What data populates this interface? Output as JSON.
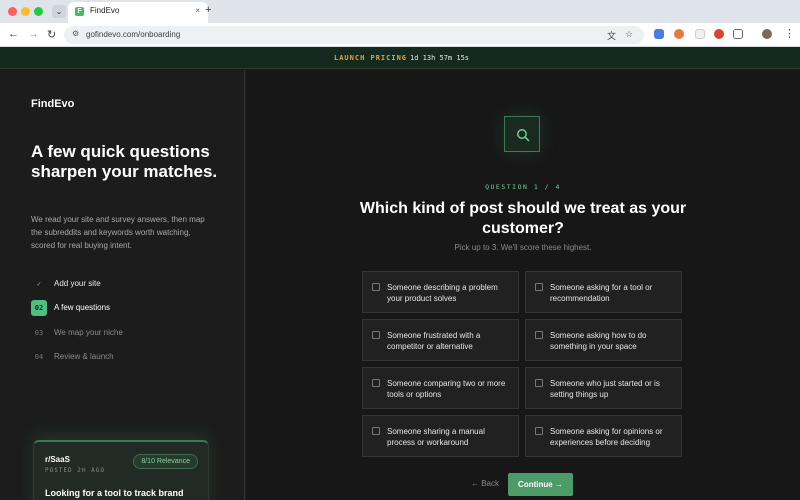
{
  "browser": {
    "tab_title": "FindEvo",
    "favicon_letter": "F",
    "new_tab": "+",
    "close_tab": "×",
    "collapse": "⌄",
    "url": "gofindevo.com/onboarding",
    "back": "←",
    "forward": "→",
    "reload": "↻",
    "menu": "⋮",
    "colors": {
      "close": "#ff5f57",
      "minimize": "#febc2e",
      "maximize": "#28c840",
      "favicon": "#3fbf63"
    }
  },
  "banner": {
    "label": "LAUNCH PRICING",
    "separator": "·",
    "timer": "1d 13h 57m 15s"
  },
  "sidebar": {
    "brand": "FindEvo",
    "headline": "A few quick questions sharpen your matches.",
    "description": "We read your site and survey answers, then map the subreddits and keywords worth watching, scored for real buying intent.",
    "steps": [
      {
        "badge": "✓",
        "label": "Add your site",
        "state": "done"
      },
      {
        "badge": "02",
        "label": "A few questions",
        "state": "active"
      },
      {
        "badge": "03",
        "label": "We map your niche",
        "state": "todo"
      },
      {
        "badge": "04",
        "label": "Review & launch",
        "state": "todo"
      }
    ],
    "preview": {
      "subreddit": "r/SaaS",
      "posted": "POSTED 2H AGO",
      "relevance": "8/10 Relevance",
      "title": "Looking for a tool to track brand"
    }
  },
  "main": {
    "icon": "search-icon",
    "counter": "QUESTION 1 / 4",
    "title": "Which kind of post should we treat as your customer?",
    "subtitle": "Pick up to 3. We'll score these highest.",
    "options": [
      "Someone describing a problem your product solves",
      "Someone asking for a tool or recommendation",
      "Someone frustrated with a competitor or alternative",
      "Someone asking how to do something in your space",
      "Someone comparing two or more tools or options",
      "Someone who just started or is setting things up",
      "Someone sharing a manual process or workaround",
      "Someone asking for opinions or experiences before deciding"
    ],
    "back_label": "← Back",
    "continue_label": "Continue →",
    "accent": "#4fbf7f"
  }
}
